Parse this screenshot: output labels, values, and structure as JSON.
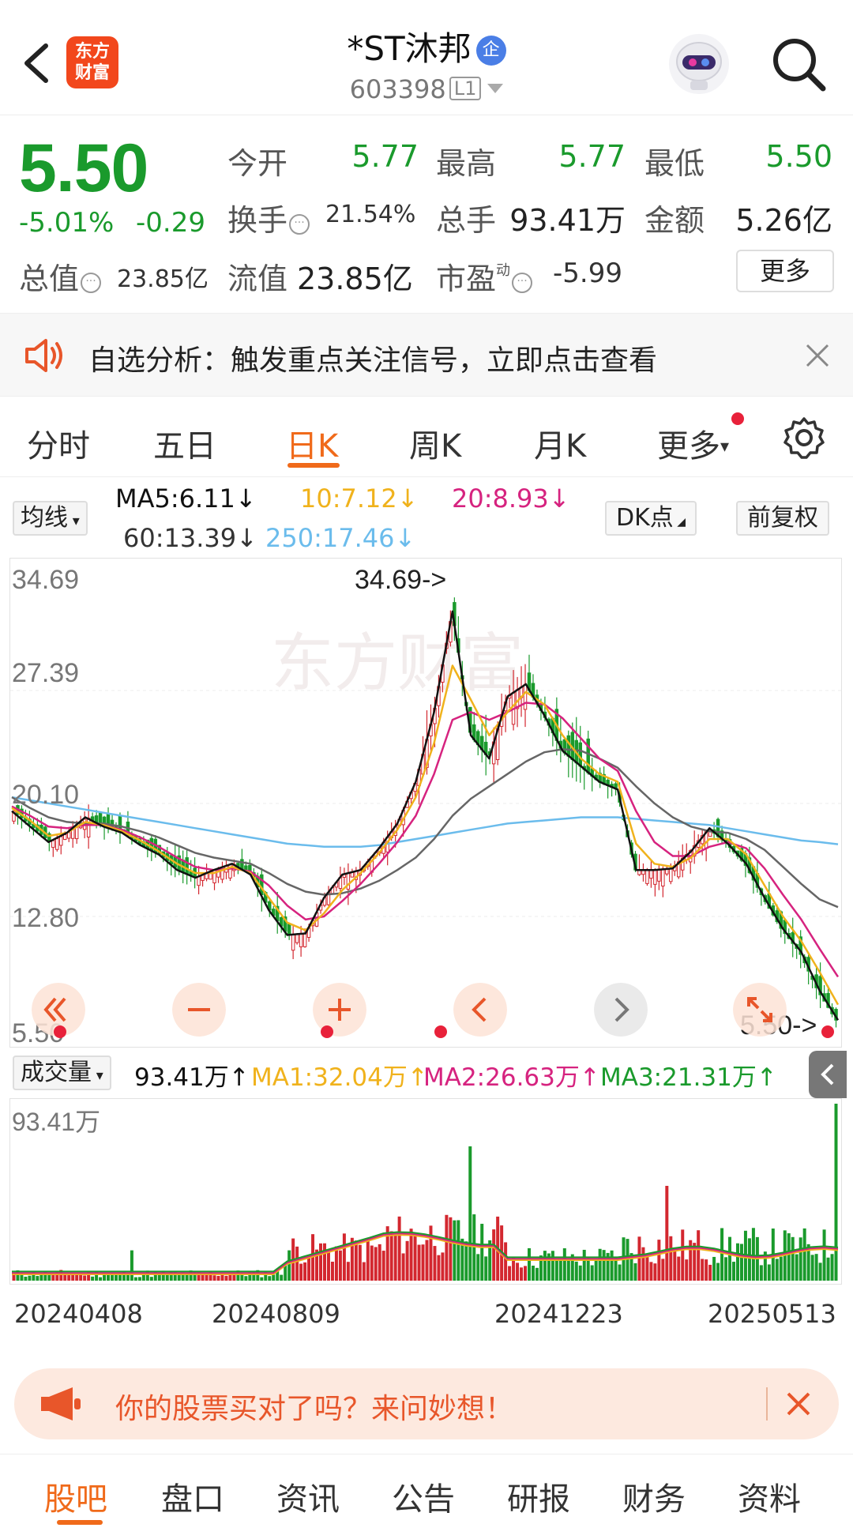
{
  "header": {
    "stock_name": "*ST沐邦",
    "badge": "企",
    "stock_code": "603398",
    "level": "L1",
    "logo_line1": "东方",
    "logo_line2": "财富"
  },
  "quote": {
    "price": "5.50",
    "change_pct": "-5.01%",
    "change_abs": "-0.29",
    "open_label": "今开",
    "open_value": "5.77",
    "high_label": "最高",
    "high_value": "5.77",
    "low_label": "最低",
    "low_value": "5.50",
    "turnover_label": "换手",
    "turnover_value": "21.54%",
    "volume_label": "总手",
    "volume_value": "93.41万",
    "amount_label": "金额",
    "amount_value": "5.26亿",
    "mktcap_label": "总值",
    "mktcap_value": "23.85亿",
    "float_label": "流值",
    "float_value": "23.85亿",
    "pe_label": "市盈",
    "pe_sup": "动",
    "pe_value": "-5.99",
    "more_label": "更多"
  },
  "alert": {
    "text": "自选分析：触发重点关注信号，立即点击查看"
  },
  "tabs": [
    "分时",
    "五日",
    "日K",
    "周K",
    "月K",
    "更多"
  ],
  "active_tab": "日K",
  "ma": {
    "selector": "均线",
    "ma5": "MA5:6.11↓",
    "ma10": "10:7.12↓",
    "ma20": "20:8.93↓",
    "ma60": "60:13.39↓",
    "ma250": "250:17.46↓",
    "dk_label": "DK点",
    "adjust_label": "前复权"
  },
  "colors": {
    "up": "#d3272f",
    "down": "#1a9a2c",
    "ma5": "#111111",
    "ma10": "#f0b21c",
    "ma20": "#d6237f",
    "ma60": "#666666",
    "ma250": "#6bbcec",
    "accent": "#f06a1a"
  },
  "chart_data": {
    "type": "candlestick",
    "y_labels": [
      "34.69",
      "27.39",
      "20.10",
      "12.80",
      "5.50"
    ],
    "ylim": [
      5.5,
      34.69
    ],
    "max_marker": "34.69->",
    "min_marker": "5.50->",
    "x_labels": [
      "20240408",
      "20240809",
      "20241223",
      "20250513"
    ],
    "ma5_path": [
      19.6,
      18.6,
      17.6,
      18.2,
      19.2,
      18.6,
      18.2,
      17.4,
      16.8,
      15.8,
      15.3,
      15.8,
      16.2,
      15.5,
      13.2,
      11.6,
      11.7,
      14.0,
      15.5,
      15.8,
      17.2,
      18.8,
      21.5,
      26.0,
      32.5,
      24.5,
      23.0,
      27.0,
      27.8,
      25.8,
      23.5,
      22.5,
      21.5,
      21.0,
      15.8,
      15.8,
      15.9,
      17.0,
      18.5,
      17.5,
      16.2,
      14.0,
      12.0,
      10.5,
      8.0,
      6.1
    ],
    "ma10_path": [
      19.8,
      19.0,
      18.0,
      18.2,
      18.9,
      18.7,
      18.3,
      17.7,
      17.0,
      16.2,
      15.6,
      15.6,
      16.0,
      15.6,
      14.0,
      12.4,
      11.9,
      13.0,
      14.5,
      15.6,
      16.9,
      18.4,
      20.5,
      24.0,
      29.0,
      26.8,
      24.5,
      26.0,
      27.3,
      26.5,
      24.5,
      23.0,
      22.0,
      21.5,
      17.5,
      16.2,
      16.0,
      16.6,
      17.8,
      17.8,
      16.8,
      14.8,
      12.8,
      11.2,
      9.2,
      7.1
    ],
    "ma20_path": [
      19.9,
      19.3,
      18.6,
      18.5,
      18.7,
      18.7,
      18.4,
      17.9,
      17.3,
      16.6,
      16.0,
      15.8,
      15.9,
      15.7,
      14.8,
      13.5,
      12.6,
      12.8,
      13.8,
      14.9,
      16.2,
      17.6,
      19.3,
      22.0,
      25.5,
      26.0,
      25.5,
      26.0,
      26.6,
      26.5,
      25.6,
      24.3,
      23.0,
      22.2,
      19.6,
      17.6,
      16.7,
      16.7,
      17.3,
      17.6,
      17.2,
      15.9,
      14.2,
      12.6,
      10.7,
      8.9
    ],
    "ma60_path": [
      20.5,
      19.8,
      19.2,
      18.9,
      18.8,
      18.8,
      18.6,
      18.3,
      17.9,
      17.4,
      16.9,
      16.6,
      16.4,
      16.2,
      15.6,
      14.9,
      14.4,
      14.2,
      14.3,
      14.6,
      15.1,
      15.8,
      16.6,
      17.8,
      19.3,
      20.4,
      21.2,
      22.0,
      22.8,
      23.4,
      23.6,
      23.5,
      23.0,
      22.4,
      21.2,
      20.1,
      19.2,
      18.6,
      18.3,
      18.2,
      17.8,
      17.1,
      16.0,
      14.9,
      13.9,
      13.4
    ],
    "ma250_path": [
      20.5,
      20.3,
      20.1,
      19.9,
      19.7,
      19.5,
      19.3,
      19.1,
      18.9,
      18.7,
      18.5,
      18.3,
      18.1,
      17.9,
      17.7,
      17.5,
      17.4,
      17.3,
      17.3,
      17.3,
      17.4,
      17.6,
      17.8,
      18.0,
      18.2,
      18.4,
      18.6,
      18.8,
      18.9,
      19.0,
      19.1,
      19.2,
      19.2,
      19.2,
      19.1,
      19.0,
      18.9,
      18.8,
      18.7,
      18.5,
      18.3,
      18.1,
      17.9,
      17.7,
      17.6,
      17.46
    ]
  },
  "volume": {
    "selector": "成交量",
    "current": "93.41万↑",
    "ma1": "MA1:32.04万↑",
    "ma2": "MA2:26.63万↑",
    "ma3": "MA3:21.31万↑",
    "max_label": "93.41万"
  },
  "promo": {
    "text": "你的股票买对了吗？来问妙想！"
  },
  "bottom_tabs": [
    "股吧",
    "盘口",
    "资讯",
    "公告",
    "研报",
    "财务",
    "资料"
  ],
  "active_bottom_tab": "股吧"
}
